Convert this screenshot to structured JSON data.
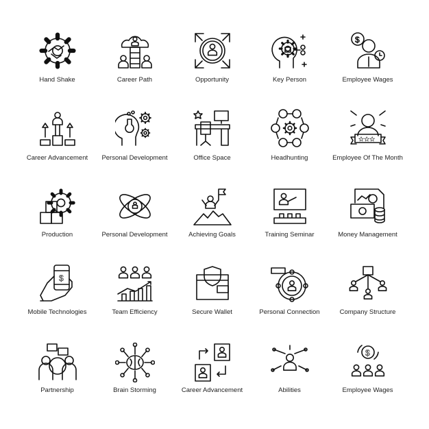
{
  "stroke_color": "#111111",
  "icons": [
    {
      "label": "Hand Shake",
      "icon": "handshake-gear-icon"
    },
    {
      "label": "Career Path",
      "icon": "career-path-icon"
    },
    {
      "label": "Opportunity",
      "icon": "opportunity-icon"
    },
    {
      "label": "Key Person",
      "icon": "key-person-icon"
    },
    {
      "label": "Employee Wages",
      "icon": "employee-wages-icon"
    },
    {
      "label": "Career Advancement",
      "icon": "career-advancement-icon"
    },
    {
      "label": "Personal Development",
      "icon": "personal-development-head-icon"
    },
    {
      "label": "Office Space",
      "icon": "office-space-icon"
    },
    {
      "label": "Headhunting",
      "icon": "headhunting-icon"
    },
    {
      "label": "Employee Of The Month",
      "icon": "employee-of-the-month-icon"
    },
    {
      "label": "Production",
      "icon": "production-icon"
    },
    {
      "label": "Personal Development",
      "icon": "personal-development-atom-icon"
    },
    {
      "label": "Achieving Goals",
      "icon": "achieving-goals-icon"
    },
    {
      "label": "Training Seminar",
      "icon": "training-seminar-icon"
    },
    {
      "label": "Money Management",
      "icon": "money-management-icon"
    },
    {
      "label": "Mobile Technologies",
      "icon": "mobile-payment-icon"
    },
    {
      "label": "Team Efficiency",
      "icon": "team-efficiency-icon"
    },
    {
      "label": "Secure Wallet",
      "icon": "secure-wallet-icon"
    },
    {
      "label": "Personal Connection",
      "icon": "personal-connection-icon"
    },
    {
      "label": "Company Structure",
      "icon": "company-structure-icon"
    },
    {
      "label": "Partnership",
      "icon": "partnership-icon"
    },
    {
      "label": "Brain Storming",
      "icon": "brain-storming-icon"
    },
    {
      "label": "Career Advancement",
      "icon": "career-swap-icon"
    },
    {
      "label": "Abilities",
      "icon": "abilities-icon"
    },
    {
      "label": "Employee Wages",
      "icon": "employee-wages-cycle-icon"
    }
  ]
}
